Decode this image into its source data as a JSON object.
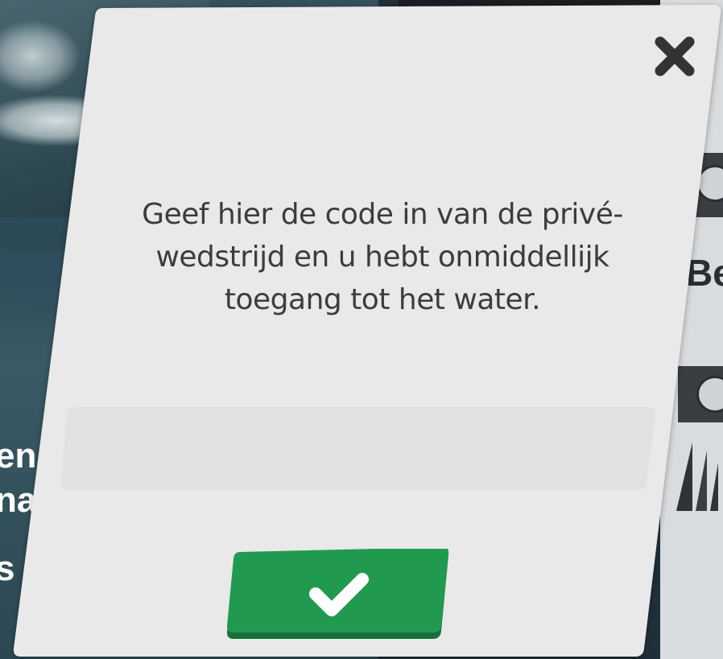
{
  "background": {
    "left_text_lines": [
      "en",
      "na",
      "s"
    ],
    "right_text": "Be"
  },
  "modal": {
    "message": "Geef hier de code in van de privé-\nwedstrijd en u hebt onmiddellijk\ntoegang tot het water.",
    "code_input": {
      "value": "",
      "placeholder": ""
    },
    "close_icon": "close-icon",
    "confirm_icon": "checkmark-icon"
  },
  "colors": {
    "modal_background": "#e9e9e9",
    "input_background": "#e1e1e1",
    "confirm_button": "#219a4f",
    "confirm_button_shadow": "#16703a",
    "close_icon": "#333333",
    "text": "#3c3c3c"
  }
}
